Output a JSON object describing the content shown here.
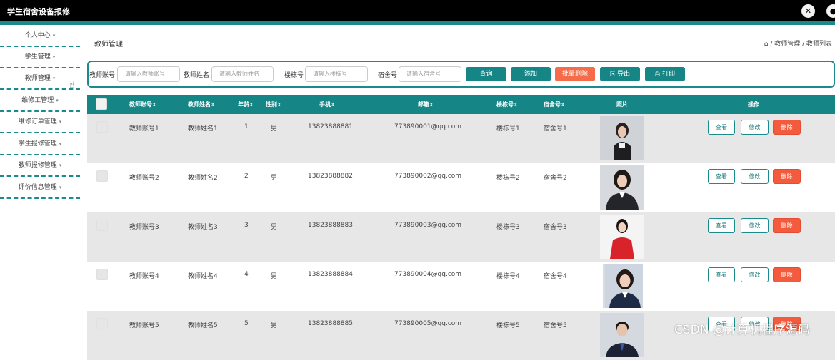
{
  "app": {
    "title": "学生宿舍设备报修"
  },
  "sidebar": {
    "items": [
      {
        "label": "个人中心"
      },
      {
        "label": "学生管理"
      },
      {
        "label": "教师管理"
      },
      {
        "label": "维修工管理"
      },
      {
        "label": "维修订单管理"
      },
      {
        "label": "学生报修管理"
      },
      {
        "label": "教师报修管理"
      },
      {
        "label": "评价信息管理"
      }
    ]
  },
  "page": {
    "title": "教师管理",
    "breadcrumb": "/ 教师管理 / 教师列表"
  },
  "search": {
    "account_label": "教师账号",
    "account_placeholder": "请输入教师账号",
    "name_label": "教师姓名",
    "name_placeholder": "请输入教师姓名",
    "building_label": "楼栋号",
    "building_placeholder": "请输入楼栋号",
    "dorm_label": "宿舍号",
    "dorm_placeholder": "请输入宿舍号",
    "query_button": "查询",
    "add_button": "添加",
    "batch_delete_button": "批量删除",
    "export_button": "导出",
    "print_button": "打印"
  },
  "table": {
    "headers": {
      "account": "教师账号",
      "name": "教师姓名",
      "age": "年龄",
      "gender": "性别",
      "phone": "手机",
      "email": "邮箱",
      "building": "楼栋号",
      "dorm": "宿舍号",
      "photo": "照片",
      "actions": "操作"
    },
    "sort_glyph": "⇕",
    "action_labels": {
      "view": "查看",
      "edit": "修改",
      "delete": "删除"
    },
    "rows": [
      {
        "account": "教师账号1",
        "name": "教师姓名1",
        "age": "1",
        "gender": "男",
        "phone": "13823888881",
        "email": "773890001@qq.com",
        "building": "楼栋号1",
        "dorm": "宿舍号1",
        "photo": "woman-dark-suit"
      },
      {
        "account": "教师账号2",
        "name": "教师姓名2",
        "age": "2",
        "gender": "男",
        "phone": "13823888882",
        "email": "773890002@qq.com",
        "building": "楼栋号2",
        "dorm": "宿舍号2",
        "photo": "woman-dark-blazer"
      },
      {
        "account": "教师账号3",
        "name": "教师姓名3",
        "age": "3",
        "gender": "男",
        "phone": "13823888883",
        "email": "773890003@qq.com",
        "building": "楼栋号3",
        "dorm": "宿舍号3",
        "photo": "woman-red-dress"
      },
      {
        "account": "教师账号4",
        "name": "教师姓名4",
        "age": "4",
        "gender": "男",
        "phone": "13823888884",
        "email": "773890004@qq.com",
        "building": "楼栋号4",
        "dorm": "宿舍号4",
        "photo": "woman-navy-blazer"
      },
      {
        "account": "教师账号5",
        "name": "教师姓名5",
        "age": "5",
        "gender": "男",
        "phone": "13823888885",
        "email": "773890005@qq.com",
        "building": "楼栋号5",
        "dorm": "宿舍号5",
        "photo": "man-suit"
      }
    ]
  },
  "watermark": "CSDN @计算机程序源码",
  "colors": {
    "accent": "#158585",
    "danger": "#f45a3c",
    "topbar": "#000000"
  }
}
